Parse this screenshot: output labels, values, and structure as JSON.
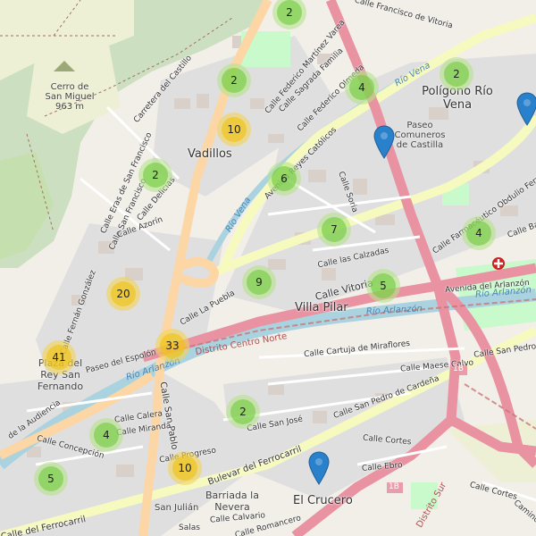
{
  "clusters": [
    {
      "count": "2",
      "size": "small"
    },
    {
      "count": "2",
      "size": "small"
    },
    {
      "count": "4",
      "size": "small"
    },
    {
      "count": "2",
      "size": "small"
    },
    {
      "count": "10",
      "size": "medium"
    },
    {
      "count": "2",
      "size": "small"
    },
    {
      "count": "6",
      "size": "small"
    },
    {
      "count": "7",
      "size": "small"
    },
    {
      "count": "4",
      "size": "small"
    },
    {
      "count": "9",
      "size": "small"
    },
    {
      "count": "5",
      "size": "small"
    },
    {
      "count": "20",
      "size": "medium"
    },
    {
      "count": "33",
      "size": "medium"
    },
    {
      "count": "41",
      "size": "medium"
    },
    {
      "count": "2",
      "size": "small"
    },
    {
      "count": "4",
      "size": "small"
    },
    {
      "count": "10",
      "size": "medium"
    },
    {
      "count": "5",
      "size": "small"
    }
  ],
  "markers": [
    "location-pin",
    "location-pin",
    "location-pin"
  ],
  "places": {
    "cerro": "Cerro de San Miguel",
    "cerro_height": "963 m",
    "vadillos": "Vadillos",
    "poligono": "Polígono Río Vena",
    "paseo": "Paseo Comuneros de Castilla",
    "villa_pilar": "Villa Pilar",
    "plaza": "Plaza del Rey San Fernando",
    "crucero": "El Crucero",
    "barriada": "Barriada la Nevera",
    "san_julian": "San Julián"
  },
  "streets": {
    "francisco_vitoria": "Calle Francisco de Vitoria",
    "federico_martinez": "Calle Federico Martínez Varea",
    "sagrada_familia": "Calle Sagrada Familia",
    "federico_olmeda": "Calle Federico Olmeda",
    "reyes_catolicos": "Avenida Reyes Católicos",
    "carretera_castillo": "Carretera del Castillo",
    "eras_san_francisco": "Calle Eras de San Francisco",
    "san_francisco": "Calle San Francisco",
    "delicias": "Calle Delicias",
    "azorin": "Calle Azorín",
    "soria": "Calle Soria",
    "las_calzadas": "Calle las Calzadas",
    "calle_vitoria": "Calle Vitoria",
    "cartuja": "Calle Cartuja de Miraflores",
    "maese_calvo": "Calle Maese Calvo",
    "san_pedro_cardena": "Calle San Pedro de Cardeña",
    "san_pedro_short": "Calle San Pedro de Ca",
    "farmaceutico": "Calle Farmacéutico Obdulio Fernández",
    "bailen": "Calle Bailén",
    "avenida_arlanzon": "Avenida del Arlanzón",
    "fernan_gonzalez": "Calle Fernán González",
    "la_puebla": "Calle La Puebla",
    "paseo_espolon": "Paseo del Espolón",
    "san_pablo": "Calle San Pablo",
    "calera": "Calle Calera",
    "miranda": "Calle Miranda",
    "progreso": "Calle Progreso",
    "concepcion": "Calle Concepción",
    "la_audiencia": "de la Audiencia",
    "san_jose": "Calle San José",
    "bulevar": "Bulevar del Ferrocarril",
    "calle_ferrocarril": "Calle del Ferrocarril",
    "calle_cortes": "Calle Cortes",
    "calle_ebro": "Calle Ebro",
    "calle_calvario": "Calle Calvario",
    "san_romancero": "Calle Romancero",
    "salas": "Salas",
    "calle_cortes_2": "Calle Cortes",
    "camino": "Camino"
  },
  "water": {
    "rio_vena": "Río Vena",
    "rio_vena_2": "Río Vena",
    "rio_arlanzon": "Río Arlanzón",
    "rio_arlanzon_2": "Río Arlanzón",
    "rio_arlanzon_3": "Río Arlanzón"
  },
  "districts": {
    "centro_norte": "Distrito Centro Norte",
    "distrito_sur": "Distrito Sur"
  },
  "route_shields": {
    "r1": "1B",
    "r2": "1B"
  },
  "colors": {
    "primary_road": "#e892a2",
    "secondary_road": "#f7fabf",
    "tertiary_road": "#fcd6a4",
    "water": "#aad3df",
    "park": "#c8facc",
    "forest": "#add19e",
    "building": "#d9d0c9",
    "pin": "#2a81cb",
    "district_line": "#c77777"
  }
}
